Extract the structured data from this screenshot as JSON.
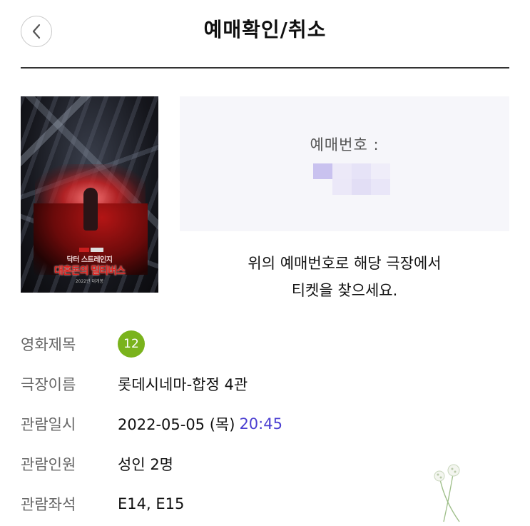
{
  "header": {
    "title": "예매확인/취소",
    "back_icon": "chevron-left-icon"
  },
  "poster": {
    "title_line1": "닥터 스트레인지",
    "title_line2": "대혼돈의 멀티버스",
    "release": "2022년 대개봉",
    "brand": "MARVEL STUDIOS"
  },
  "booking": {
    "label": "예매번호 :",
    "code_blurred": true
  },
  "notice": {
    "line1": "위의 예매번호로 해당 극장에서",
    "line2": "티켓을 찾으세요."
  },
  "details": {
    "movie_label": "영화제목",
    "movie_rating": "12",
    "theater_label": "극장이름",
    "theater_value": "롯데시네마-합정 4관",
    "datetime_label": "관람일시",
    "date_value": "2022-05-05 (목)",
    "time_value": "20:45",
    "people_label": "관람인원",
    "people_value": "성인 2명",
    "seats_label": "관람좌석",
    "seats_value": "E14, E15"
  },
  "colors": {
    "accent_time": "#4b3fd1",
    "rating_badge": "#7ab31c",
    "booking_box_bg": "#f6f6fa"
  }
}
